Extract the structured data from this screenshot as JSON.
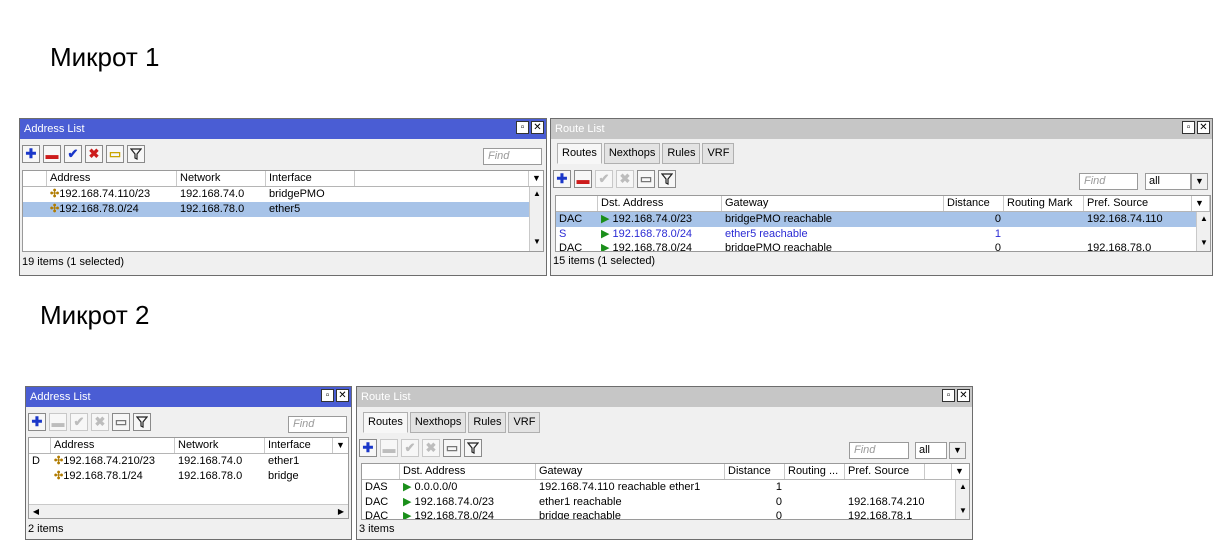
{
  "heading1": "Микрот 1",
  "heading2": "Микрот 2",
  "m1": {
    "addr": {
      "title": "Address List",
      "find_placeholder": "Find",
      "columns": [
        "Address",
        "Network",
        "Interface"
      ],
      "rows": [
        {
          "flag": "",
          "address": "192.168.74.110/23",
          "network": "192.168.74.0",
          "interface": "bridgePMO"
        },
        {
          "flag": "",
          "address": "192.168.78.0/24",
          "network": "192.168.78.0",
          "interface": "ether5"
        }
      ],
      "status": "19 items (1 selected)"
    },
    "route": {
      "title": "Route List",
      "tabs": [
        "Routes",
        "Nexthops",
        "Rules",
        "VRF"
      ],
      "find_placeholder": "Find",
      "filter_value": "all",
      "columns": [
        "Dst. Address",
        "Gateway",
        "Distance",
        "Routing Mark",
        "Pref. Source"
      ],
      "rows": [
        {
          "flag": "DAC",
          "dst": "192.168.74.0/23",
          "gateway": "bridgePMO reachable",
          "distance": "0",
          "mark": "",
          "pref": "192.168.74.110"
        },
        {
          "flag": "S",
          "dst": "192.168.78.0/24",
          "gateway": "ether5 reachable",
          "distance": "1",
          "mark": "",
          "pref": ""
        },
        {
          "flag": "DAC",
          "dst": "192.168.78.0/24",
          "gateway": "bridgePMO reachable",
          "distance": "0",
          "mark": "",
          "pref": "192.168.78.0"
        }
      ],
      "status": "15 items (1 selected)"
    }
  },
  "m2": {
    "addr": {
      "title": "Address List",
      "find_placeholder": "Find",
      "columns": [
        "Address",
        "Network",
        "Interface"
      ],
      "rows": [
        {
          "flag": "D",
          "address": "192.168.74.210/23",
          "network": "192.168.74.0",
          "interface": "ether1"
        },
        {
          "flag": "",
          "address": "192.168.78.1/24",
          "network": "192.168.78.0",
          "interface": "bridge"
        }
      ],
      "status": "2 items"
    },
    "route": {
      "title": "Route List",
      "tabs": [
        "Routes",
        "Nexthops",
        "Rules",
        "VRF"
      ],
      "find_placeholder": "Find",
      "filter_value": "all",
      "columns": [
        "Dst. Address",
        "Gateway",
        "Distance",
        "Routing ...",
        "Pref. Source"
      ],
      "rows": [
        {
          "flag": "DAS",
          "dst": "0.0.0.0/0",
          "gateway": "192.168.74.110 reachable ether1",
          "distance": "1",
          "mark": "",
          "pref": ""
        },
        {
          "flag": "DAC",
          "dst": "192.168.74.0/23",
          "gateway": "ether1 reachable",
          "distance": "0",
          "mark": "",
          "pref": "192.168.74.210"
        },
        {
          "flag": "DAC",
          "dst": "192.168.78.0/24",
          "gateway": "bridge reachable",
          "distance": "0",
          "mark": "",
          "pref": "192.168.78.1"
        }
      ],
      "status": "3 items"
    }
  },
  "colors": {
    "title_active": "#4a5dd4",
    "title_inactive": "#c6c6c6",
    "selection": "#a7c3e8",
    "static_route": "#2b2bd4"
  }
}
